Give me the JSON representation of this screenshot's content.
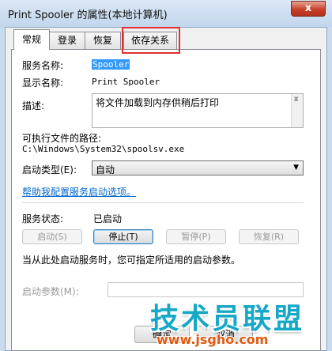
{
  "window": {
    "title": "Print Spooler 的属性(本地计算机)",
    "close_label": "x"
  },
  "tabs": [
    {
      "label": "常规",
      "active": true
    },
    {
      "label": "登录",
      "active": false
    },
    {
      "label": "恢复",
      "active": false
    },
    {
      "label": "依存关系",
      "active": false
    }
  ],
  "general": {
    "service_name_label": "服务名称:",
    "service_name_value": "Spooler",
    "display_name_label": "显示名称:",
    "display_name_value": "Print Spooler",
    "description_label": "描述:",
    "description_value": "将文件加载到内存供稍后打印",
    "exe_path_label": "可执行文件的路径:",
    "exe_path_value": "C:\\Windows\\System32\\spoolsv.exe",
    "startup_type_label": "启动类型(E):",
    "startup_type_value": "自动",
    "help_link": "帮助我配置服务启动选项。",
    "service_status_label": "服务状态:",
    "service_status_value": "已启动",
    "buttons": {
      "start": "启动(S)",
      "stop": "停止(T)",
      "pause": "暂停(P)",
      "resume": "恢复(R)"
    },
    "hint_text": "当从此处启动服务时，您可指定所适用的启动参数。",
    "start_params_label": "启动参数(M):",
    "start_params_value": ""
  },
  "footer": {
    "ok_label": "确定",
    "cancel_label": "取消"
  },
  "watermark": {
    "brand": "技术员联盟",
    "url": "www.jsgho.com"
  },
  "colors": {
    "highlight_box": "#e23030",
    "selection": "#3399ff",
    "link": "#0066cc"
  }
}
